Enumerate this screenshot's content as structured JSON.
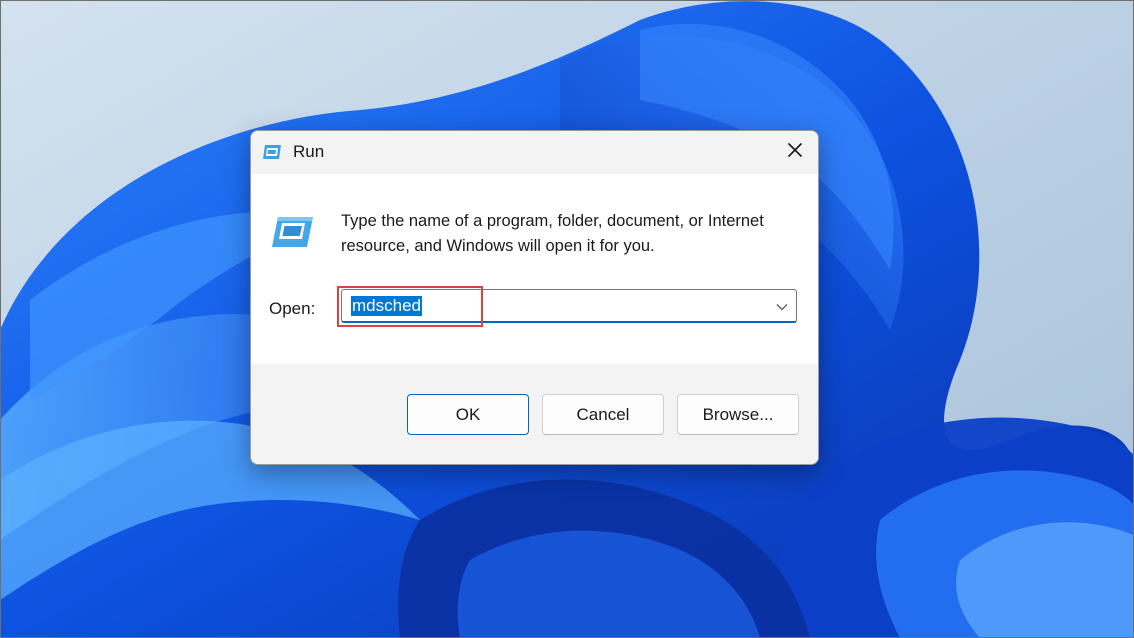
{
  "desktop": {
    "accent": "#0a5cf0"
  },
  "run_dialog": {
    "title": "Run",
    "title_icon": "run-app-icon",
    "close_icon": "close-icon",
    "description": "Type the name of a program, folder, document, or Internet resource, and Windows will open it for you.",
    "open_label": "Open:",
    "open_value": "mdsched",
    "dropdown_icon": "chevron-down-icon",
    "buttons": {
      "ok": "OK",
      "cancel": "Cancel",
      "browse": "Browse..."
    },
    "colors": {
      "selection": "#0078d4",
      "input_focus": "#0067c0",
      "annotation": "#e04040"
    }
  }
}
